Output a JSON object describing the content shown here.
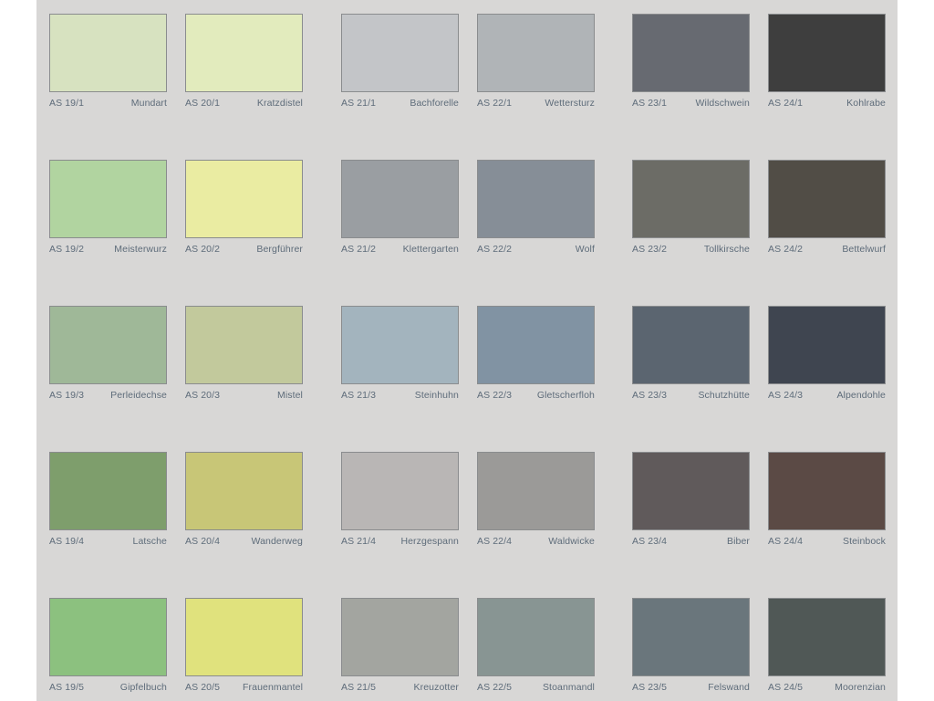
{
  "groups": [
    {
      "columns": [
        {
          "items": [
            {
              "code": "AS 19/1",
              "name": "Mundart",
              "color": "#d7e2c0"
            },
            {
              "code": "AS 19/2",
              "name": "Meisterwurz",
              "color": "#b1d4a0"
            },
            {
              "code": "AS 19/3",
              "name": "Perleidechse",
              "color": "#9fb898"
            },
            {
              "code": "AS 19/4",
              "name": "Latsche",
              "color": "#7e9e6c"
            },
            {
              "code": "AS 19/5",
              "name": "Gipfelbuch",
              "color": "#8cc17f"
            }
          ]
        },
        {
          "items": [
            {
              "code": "AS 20/1",
              "name": "Kratzdistel",
              "color": "#e2ebbd"
            },
            {
              "code": "AS 20/2",
              "name": "Bergführer",
              "color": "#eaeca2"
            },
            {
              "code": "AS 20/3",
              "name": "Mistel",
              "color": "#c2c99c"
            },
            {
              "code": "AS 20/4",
              "name": "Wanderweg",
              "color": "#c8c677"
            },
            {
              "code": "AS 20/5",
              "name": "Frauenmantel",
              "color": "#e0e27d"
            }
          ]
        }
      ]
    },
    {
      "columns": [
        {
          "items": [
            {
              "code": "AS 21/1",
              "name": "Bachforelle",
              "color": "#c3c5c8"
            },
            {
              "code": "AS 21/2",
              "name": "Klettergarten",
              "color": "#9a9ea2"
            },
            {
              "code": "AS 21/3",
              "name": "Steinhuhn",
              "color": "#a3b4be"
            },
            {
              "code": "AS 21/4",
              "name": "Herzgespann",
              "color": "#b9b6b5"
            },
            {
              "code": "AS 21/5",
              "name": "Kreuzotter",
              "color": "#a3a5a0"
            }
          ]
        },
        {
          "items": [
            {
              "code": "AS 22/1",
              "name": "Wettersturz",
              "color": "#b0b4b7"
            },
            {
              "code": "AS 22/2",
              "name": "Wolf",
              "color": "#868e97"
            },
            {
              "code": "AS 22/3",
              "name": "Gletscherfloh",
              "color": "#8193a3"
            },
            {
              "code": "AS 22/4",
              "name": "Waldwicke",
              "color": "#9b9a98"
            },
            {
              "code": "AS 22/5",
              "name": "Stoanmandl",
              "color": "#889593"
            }
          ]
        }
      ]
    },
    {
      "columns": [
        {
          "items": [
            {
              "code": "AS 23/1",
              "name": "Wildschwein",
              "color": "#676a71"
            },
            {
              "code": "AS 23/2",
              "name": "Tollkirsche",
              "color": "#6c6c66"
            },
            {
              "code": "AS 23/3",
              "name": "Schutzhütte",
              "color": "#5b6570"
            },
            {
              "code": "AS 23/4",
              "name": "Biber",
              "color": "#605a5b"
            },
            {
              "code": "AS 23/5",
              "name": "Felswand",
              "color": "#6a767c"
            }
          ]
        },
        {
          "items": [
            {
              "code": "AS 24/1",
              "name": "Kohlrabe",
              "color": "#3e3e3e"
            },
            {
              "code": "AS 24/2",
              "name": "Bettelwurf",
              "color": "#514d46"
            },
            {
              "code": "AS 24/3",
              "name": "Alpendohle",
              "color": "#3f4550"
            },
            {
              "code": "AS 24/4",
              "name": "Steinbock",
              "color": "#5b4a45"
            },
            {
              "code": "AS 24/5",
              "name": "Moorenzian",
              "color": "#505856"
            }
          ]
        }
      ]
    }
  ]
}
